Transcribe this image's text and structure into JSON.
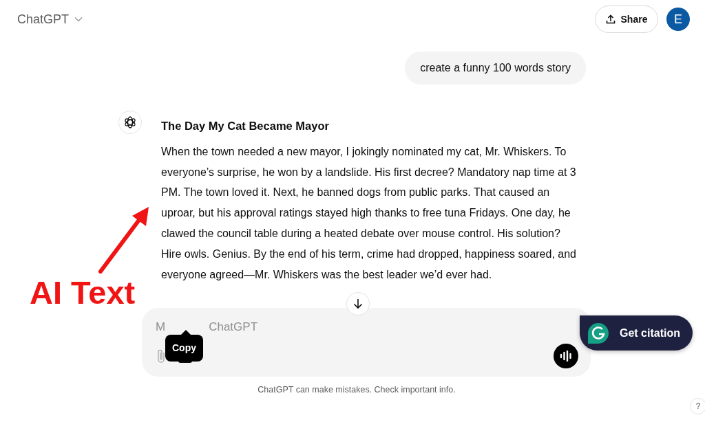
{
  "header": {
    "title": "ChatGPT"
  },
  "share_button": {
    "label": "Share"
  },
  "avatar": {
    "initial": "E"
  },
  "user_message": "create a funny 100 words story",
  "response": {
    "title": "The Day My Cat Became Mayor",
    "body": "When the town needed a new mayor, I jokingly nominated my cat, Mr. Whiskers. To everyone’s surprise, he won by a landslide. His first decree? Mandatory nap time at 3 PM. The town loved it. Next, he banned dogs from public parks. That caused an uproar, but his approval ratings stayed high thanks to free tuna Fridays. One day, he clawed the council table during a heated debate over mouse control. His solution? Hire owls. Genius. By the end of his term, crime had dropped, happiness soared, and everyone agreed—Mr. Whiskers was the best leader we’d ever had."
  },
  "composer": {
    "placeholder_parts": [
      "M",
      "ChatGPT"
    ]
  },
  "tooltip": {
    "label": "Copy"
  },
  "footer": "ChatGPT can make mistakes. Check important info.",
  "citation_button": {
    "label": "Get citation"
  },
  "help_button": {
    "label": "?"
  },
  "annotation": {
    "label": "AI Text"
  }
}
